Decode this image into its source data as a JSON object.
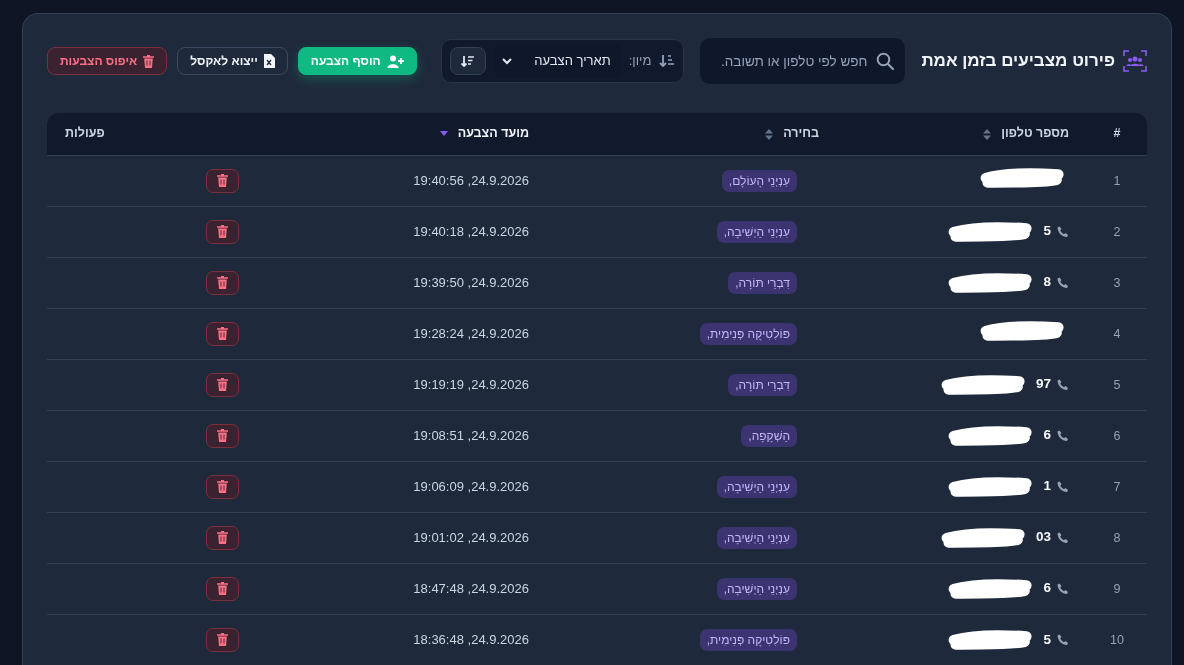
{
  "header": {
    "title": "פירוט מצביעים בזמן אמת",
    "search": {
      "placeholder": "חפש לפי טלפון או תשובה."
    },
    "sort": {
      "label": "מיון:",
      "value": "תאריך הצבעה"
    },
    "buttons": [
      {
        "kind": "add",
        "label": "הוסף הצבעה"
      },
      {
        "kind": "export",
        "label": "ייצוא לאקסל"
      },
      {
        "kind": "reset",
        "label": "איפוס הצבעות"
      }
    ]
  },
  "table": {
    "columns": [
      {
        "label": "#"
      },
      {
        "label": "מספר טלפון",
        "sortable": true,
        "sorted": false
      },
      {
        "label": "בחירה",
        "sortable": true,
        "sorted": false
      },
      {
        "label": "מועד הצבעה",
        "sortable": true,
        "sorted": true
      },
      {
        "label": "פעולות"
      }
    ],
    "rows": [
      {
        "index": "1",
        "redacted": true,
        "choice": "עִנְיְנֵי הָעוֹלָם,",
        "time": "24.9.2026, 19:40:56"
      },
      {
        "index": "2",
        "phone": "5",
        "redacted": true,
        "choice": "עִנְיְנֵי הַיְשִׁיבָה,",
        "time": "24.9.2026, 19:40:18"
      },
      {
        "index": "3",
        "phone": "8",
        "redacted": true,
        "choice": "דִּבְרֵי תּוֹרָה,",
        "time": "24.9.2026, 19:39:50"
      },
      {
        "index": "4",
        "redacted": true,
        "choice": "פּוֹלִטִיקָה פְּנִימִית,",
        "time": "24.9.2026, 19:28:24"
      },
      {
        "index": "5",
        "phone": "97",
        "redacted": true,
        "choice": "דִּבְרֵי תּוֹרָה,",
        "time": "24.9.2026, 19:19:19"
      },
      {
        "index": "6",
        "phone": "6",
        "redacted": true,
        "choice": "הַשְׁקָפָה,",
        "time": "24.9.2026, 19:08:51"
      },
      {
        "index": "7",
        "phone": "1",
        "redacted": true,
        "choice": "עִנְיְנֵי הַיְשִׁיבָה,",
        "time": "24.9.2026, 19:06:09"
      },
      {
        "index": "8",
        "phone": "03",
        "redacted": true,
        "choice": "עִנְיְנֵי הַיְשִׁיבָה,",
        "time": "24.9.2026, 19:01:02"
      },
      {
        "index": "9",
        "phone": "6",
        "redacted": true,
        "choice": "עִנְיְנֵי הַיְשִׁיבָה,",
        "time": "24.9.2026, 18:47:48"
      },
      {
        "index": "10",
        "phone": "5",
        "redacted": true,
        "choice": "פּוֹלִטִיקָה פְּנִימִית,",
        "time": "24.9.2026, 18:36:48"
      }
    ]
  }
}
